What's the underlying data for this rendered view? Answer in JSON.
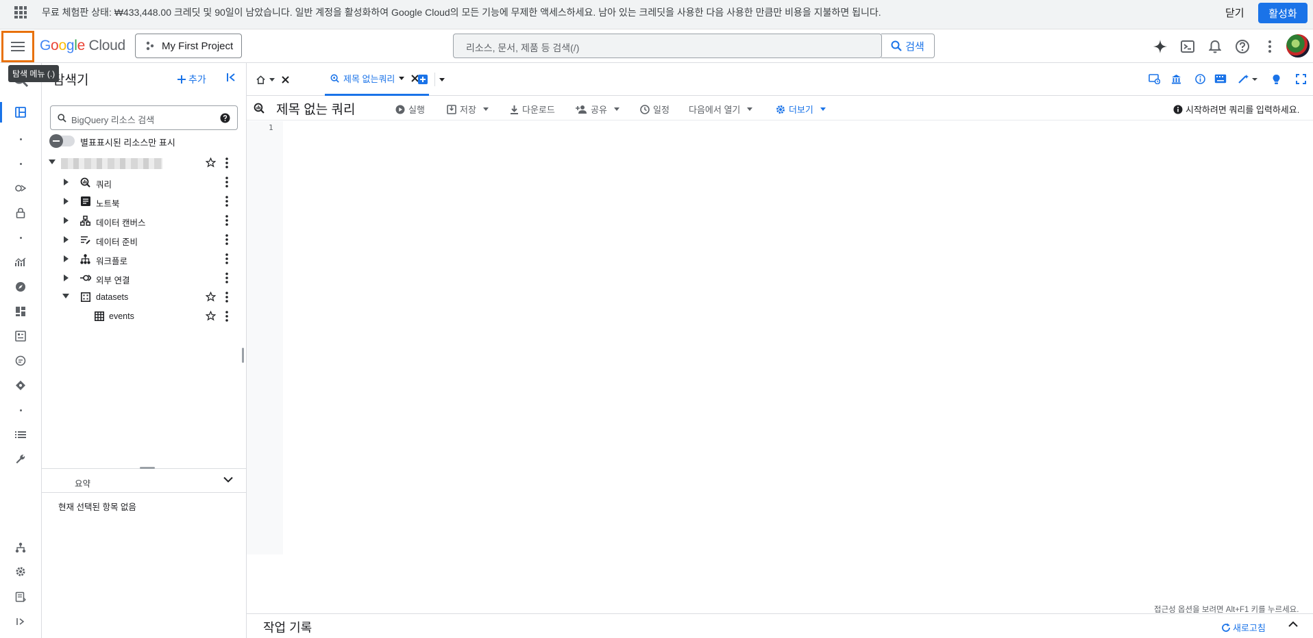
{
  "banner": {
    "message": "무료 체험판 상태: ₩433,448.00 크레딧 및 90일이 남았습니다. 일반 계정을 활성화하여 Google Cloud의 모든 기능에 무제한 액세스하세요. 남아 있는 크레딧을 사용한 다음 사용한 만큼만 비용을 지불하면 됩니다.",
    "close_label": "닫기",
    "activate_label": "활성화"
  },
  "header": {
    "logo_parts": [
      "G",
      "o",
      "o",
      "g",
      "l",
      "e"
    ],
    "logo_suffix": "Cloud",
    "project_name": "My First Project",
    "search_placeholder": "리소스, 문서, 제품 등 검색(/)",
    "search_button": "검색"
  },
  "tooltip": {
    "text": "탐색 메뉴 (.)"
  },
  "explorer": {
    "title": "탐색기",
    "add_label": "추가",
    "search_placeholder": "BigQuery 리소스 검색",
    "starred_only_label": "별표표시된 리소스만 표시",
    "items": [
      {
        "label": "쿼리",
        "icon": "query-icon"
      },
      {
        "label": "노트북",
        "icon": "notebook-icon"
      },
      {
        "label": "데이터 캔버스",
        "icon": "canvas-icon"
      },
      {
        "label": "데이터 준비",
        "icon": "data-prep-icon"
      },
      {
        "label": "워크플로",
        "icon": "workflow-icon"
      },
      {
        "label": "외부 연결",
        "icon": "connection-icon"
      },
      {
        "label": "datasets",
        "icon": "dataset-icon"
      }
    ],
    "table": {
      "label": "events",
      "icon": "table-icon"
    },
    "summary_label": "요약",
    "summary_empty": "현재 선택된 항목 없음"
  },
  "tabs": {
    "query_tab": "제목 없는쿼리"
  },
  "toolbar": {
    "title": "제목 없는 쿼리",
    "run": "실행",
    "save": "저장",
    "download": "다운로드",
    "share": "공유",
    "schedule": "일정",
    "open_in": "다음에서 열기",
    "more": "더보기",
    "hint": "시작하려면 쿼리를 입력하세요."
  },
  "editor": {
    "line_number": "1",
    "a11y_hint": "접근성 옵션을 보려면 Alt+F1 키를 누르세요."
  },
  "jobs": {
    "title": "작업 기록",
    "refresh": "새로고침"
  },
  "colors": {
    "accent": "#1a73e8",
    "highlight": "#e8710a"
  }
}
